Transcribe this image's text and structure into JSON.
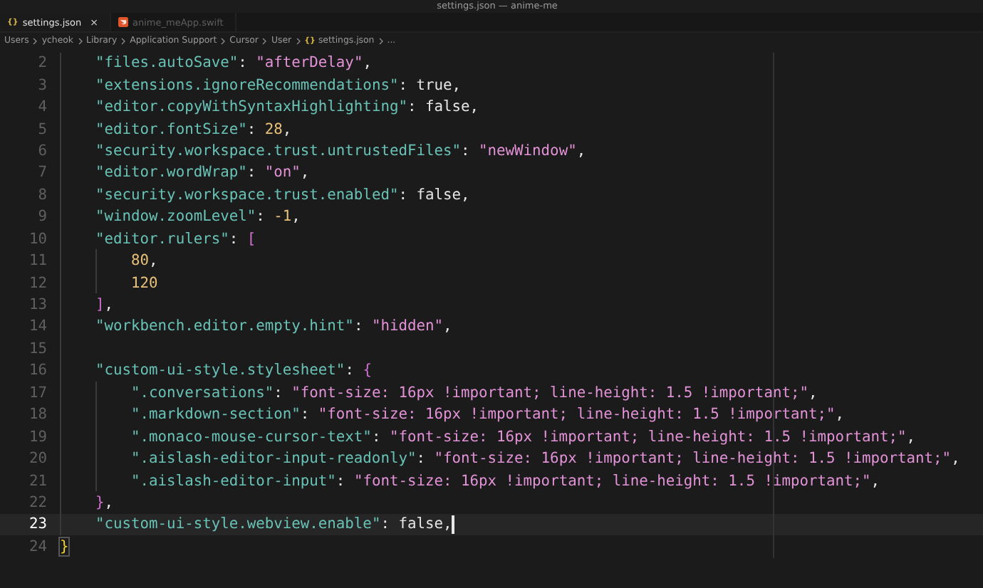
{
  "window": {
    "title": "settings.json — anime-me"
  },
  "tabs": [
    {
      "label": "settings.json",
      "icon": "{}",
      "kind": "json",
      "selected": true,
      "close": "×"
    },
    {
      "label": "anime_meApp.swift",
      "kind": "swift",
      "selected": false
    }
  ],
  "breadcrumb": [
    {
      "text": "Users"
    },
    {
      "text": "ycheok"
    },
    {
      "text": "Library"
    },
    {
      "text": "Application Support"
    },
    {
      "text": "Cursor"
    },
    {
      "text": "User"
    },
    {
      "text": "settings.json",
      "icon": "{}"
    },
    {
      "text": "..."
    }
  ],
  "editor": {
    "lines": [
      {
        "number": "2",
        "current": false,
        "kind": "member",
        "tokens": [
          {
            "kind": "key",
            "text": "\"files.autoSave\""
          },
          {
            "kind": "punct",
            "text": ": "
          },
          {
            "kind": "string",
            "text": "\"afterDelay\""
          },
          {
            "kind": "punct",
            "text": ","
          }
        ]
      },
      {
        "number": "3",
        "current": false,
        "kind": "member",
        "tokens": [
          {
            "kind": "key",
            "text": "\"extensions.ignoreRecommendations\""
          },
          {
            "kind": "punct",
            "text": ": "
          },
          {
            "kind": "literal",
            "text": "true"
          },
          {
            "kind": "punct",
            "text": ","
          }
        ]
      },
      {
        "number": "4",
        "current": false,
        "kind": "member",
        "tokens": [
          {
            "kind": "key",
            "text": "\"editor.copyWithSyntaxHighlighting\""
          },
          {
            "kind": "punct",
            "text": ": "
          },
          {
            "kind": "literal",
            "text": "false"
          },
          {
            "kind": "punct",
            "text": ","
          }
        ]
      },
      {
        "number": "5",
        "current": false,
        "kind": "member",
        "tokens": [
          {
            "kind": "key",
            "text": "\"editor.fontSize\""
          },
          {
            "kind": "punct",
            "text": ": "
          },
          {
            "kind": "number",
            "text": "28"
          },
          {
            "kind": "punct",
            "text": ","
          }
        ]
      },
      {
        "number": "6",
        "current": false,
        "kind": "member",
        "tokens": [
          {
            "kind": "key",
            "text": "\"security.workspace.trust.untrustedFiles\""
          },
          {
            "kind": "punct",
            "text": ": "
          },
          {
            "kind": "string",
            "text": "\"newWindow\""
          },
          {
            "kind": "punct",
            "text": ","
          }
        ]
      },
      {
        "number": "7",
        "current": false,
        "kind": "member",
        "tokens": [
          {
            "kind": "key",
            "text": "\"editor.wordWrap\""
          },
          {
            "kind": "punct",
            "text": ": "
          },
          {
            "kind": "string",
            "text": "\"on\""
          },
          {
            "kind": "punct",
            "text": ","
          }
        ]
      },
      {
        "number": "8",
        "current": false,
        "kind": "member",
        "tokens": [
          {
            "kind": "key",
            "text": "\"security.workspace.trust.enabled\""
          },
          {
            "kind": "punct",
            "text": ": "
          },
          {
            "kind": "literal",
            "text": "false"
          },
          {
            "kind": "punct",
            "text": ","
          }
        ]
      },
      {
        "number": "9",
        "current": false,
        "kind": "member",
        "tokens": [
          {
            "kind": "key",
            "text": "\"window.zoomLevel\""
          },
          {
            "kind": "punct",
            "text": ": "
          },
          {
            "kind": "number",
            "text": "-1"
          },
          {
            "kind": "punct",
            "text": ","
          }
        ]
      },
      {
        "number": "10",
        "current": false,
        "kind": "member",
        "tokens": [
          {
            "kind": "key",
            "text": "\"editor.rulers\""
          },
          {
            "kind": "punct",
            "text": ": "
          },
          {
            "kind": "bracket",
            "text": "["
          }
        ]
      },
      {
        "number": "11",
        "current": false,
        "kind": "item",
        "tokens": [
          {
            "kind": "number",
            "text": "80"
          },
          {
            "kind": "punct",
            "text": ","
          }
        ]
      },
      {
        "number": "12",
        "current": false,
        "kind": "item",
        "tokens": [
          {
            "kind": "number",
            "text": "120"
          }
        ]
      },
      {
        "number": "13",
        "current": false,
        "kind": "member",
        "tokens": [
          {
            "kind": "bracket",
            "text": "]"
          },
          {
            "kind": "punct",
            "text": ","
          }
        ]
      },
      {
        "number": "14",
        "current": false,
        "kind": "member",
        "tokens": [
          {
            "kind": "key",
            "text": "\"workbench.editor.empty.hint\""
          },
          {
            "kind": "punct",
            "text": ": "
          },
          {
            "kind": "string",
            "text": "\"hidden\""
          },
          {
            "kind": "punct",
            "text": ","
          }
        ]
      },
      {
        "number": "15",
        "current": false,
        "kind": "member"
      },
      {
        "number": "16",
        "current": false,
        "kind": "member",
        "tokens": [
          {
            "kind": "key",
            "text": "\"custom-ui-style.stylesheet\""
          },
          {
            "kind": "punct",
            "text": ": "
          },
          {
            "kind": "bracket",
            "text": "{"
          }
        ]
      },
      {
        "number": "17",
        "current": false,
        "kind": "item",
        "tokens": [
          {
            "kind": "key",
            "text": "\".conversations\""
          },
          {
            "kind": "punct",
            "text": ": "
          },
          {
            "kind": "string",
            "text": "\"font-size: 16px !important; line-height: 1.5 !important;\""
          },
          {
            "kind": "punct",
            "text": ","
          }
        ]
      },
      {
        "number": "18",
        "current": false,
        "kind": "item",
        "tokens": [
          {
            "kind": "key",
            "text": "\".markdown-section\""
          },
          {
            "kind": "punct",
            "text": ": "
          },
          {
            "kind": "string",
            "text": "\"font-size: 16px !important; line-height: 1.5 !important;\""
          },
          {
            "kind": "punct",
            "text": ","
          }
        ]
      },
      {
        "number": "19",
        "current": false,
        "kind": "item",
        "tokens": [
          {
            "kind": "key",
            "text": "\".monaco-mouse-cursor-text\""
          },
          {
            "kind": "punct",
            "text": ": "
          },
          {
            "kind": "string",
            "text": "\"font-size: 16px !important; line-height: 1.5 !important;\""
          },
          {
            "kind": "punct",
            "text": ","
          }
        ]
      },
      {
        "number": "20",
        "current": false,
        "kind": "item",
        "tokens": [
          {
            "kind": "key",
            "text": "\".aislash-editor-input-readonly\""
          },
          {
            "kind": "punct",
            "text": ": "
          },
          {
            "kind": "string",
            "text": "\"font-size: 16px !important; line-height: 1.5 !important;\""
          },
          {
            "kind": "punct",
            "text": ","
          }
        ]
      },
      {
        "number": "21",
        "current": false,
        "kind": "item",
        "tokens": [
          {
            "kind": "key",
            "text": "\".aislash-editor-input\""
          },
          {
            "kind": "punct",
            "text": ": "
          },
          {
            "kind": "string",
            "text": "\"font-size: 16px !important; line-height: 1.5 !important;\""
          },
          {
            "kind": "punct",
            "text": ","
          }
        ]
      },
      {
        "number": "22",
        "current": false,
        "kind": "member",
        "tokens": [
          {
            "kind": "bracket",
            "text": "}"
          },
          {
            "kind": "punct",
            "text": ","
          }
        ]
      },
      {
        "number": "23",
        "current": true,
        "kind": "member",
        "tokens": [
          {
            "kind": "key",
            "text": "\"custom-ui-style.webview.enable\""
          },
          {
            "kind": "punct",
            "text": ": "
          },
          {
            "kind": "literal",
            "text": "false"
          },
          {
            "kind": "punct",
            "text": ","
          }
        ]
      },
      {
        "number": "24",
        "current": false,
        "kind": "root",
        "tokens": [
          {
            "kind": "outer",
            "text": "}"
          }
        ]
      }
    ]
  }
}
